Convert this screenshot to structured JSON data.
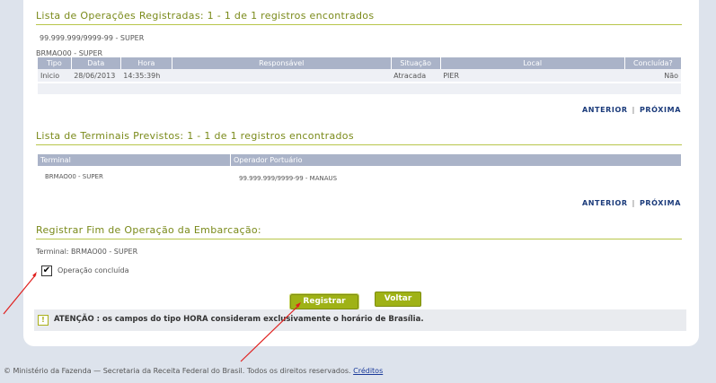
{
  "operations": {
    "title": "Lista de Operações Registradas: 1 - 1 de 1 registros encontrados",
    "cnpj_line": "99.999.999/9999-99 - SUPER",
    "terminal_line": "BRMAO00   - SUPER",
    "columns": [
      "Tipo",
      "Data",
      "Hora",
      "Responsável",
      "Situação",
      "Local",
      "Concluída?"
    ],
    "row": [
      "Inicio",
      "28/06/2013",
      "14:35:39h",
      "",
      "Atracada",
      "PIER",
      "Não"
    ]
  },
  "pager": {
    "prev": "ANTERIOR",
    "sep": "|",
    "next": "PRÓXIMA"
  },
  "terminals": {
    "title": "Lista de Terminais Previstos: 1 - 1 de 1 registros encontrados",
    "columns": [
      "Terminal",
      "Operador Portuário"
    ],
    "row": [
      "BRMAO00 - SUPER",
      "99.999.999/9999-99 - MANAUS"
    ]
  },
  "register": {
    "title": "Registrar Fim de Operação da Embarcação:",
    "terminal_line": "Terminal: BRMAO00   - SUPER",
    "checkbox_label": "Operação concluída",
    "checkbox_mark": "✔",
    "btn_register": "Registrar",
    "btn_back": "Voltar"
  },
  "attention": {
    "icon": "!",
    "text": "ATENÇÃO : os campos do tipo HORA consideram exclusivamente o horário de Brasília."
  },
  "footer": {
    "text": "© Ministério da Fazenda — Secretaria da Receita Federal do Brasil. Todos os direitos reservados.",
    "link": "Créditos"
  },
  "colors": {
    "accent": "#9fb216",
    "header": "#aab3c8",
    "arrow": "#e0201e"
  }
}
